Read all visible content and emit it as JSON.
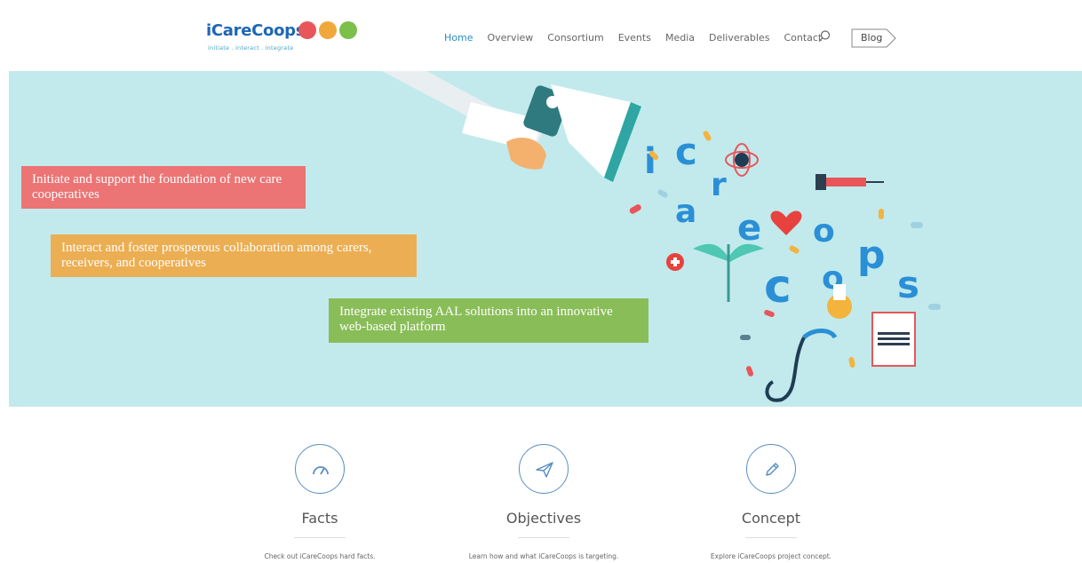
{
  "brand": {
    "name": "iCareCoops",
    "tagline": "initiate . interact . integrate",
    "colors": {
      "primary": "#1d66b5",
      "dot1": "#e8565a",
      "dot2": "#f0a83a",
      "dot3": "#7cbf4a"
    }
  },
  "nav": {
    "items": [
      {
        "label": "Home",
        "active": true
      },
      {
        "label": "Overview",
        "active": false
      },
      {
        "label": "Consortium",
        "active": false
      },
      {
        "label": "Events",
        "active": false
      },
      {
        "label": "Media",
        "active": false
      },
      {
        "label": "Deliverables",
        "active": false
      },
      {
        "label": "Contact",
        "active": false
      }
    ],
    "search_icon": "search-icon",
    "blog_label": "Blog"
  },
  "hero": {
    "background": "#c2eaec",
    "banners": [
      {
        "text": "Initiate and support the foundation of new care cooperatives",
        "color": "#ec7474"
      },
      {
        "text": "Interact and foster prosperous collaboration among carers, receivers, and cooperatives",
        "color": "#ecae52"
      },
      {
        "text": "Integrate existing AAL solutions into an innovative web-based platform",
        "color": "#89bd58"
      }
    ]
  },
  "features": [
    {
      "icon": "gauge-icon",
      "title": "Facts",
      "description": "Check out iCareCoops hard facts."
    },
    {
      "icon": "paper-plane-icon",
      "title": "Objectives",
      "description": "Learn how and what iCareCoops is targeting."
    },
    {
      "icon": "pencil-icon",
      "title": "Concept",
      "description": "Explore iCareCoops project concept."
    }
  ]
}
